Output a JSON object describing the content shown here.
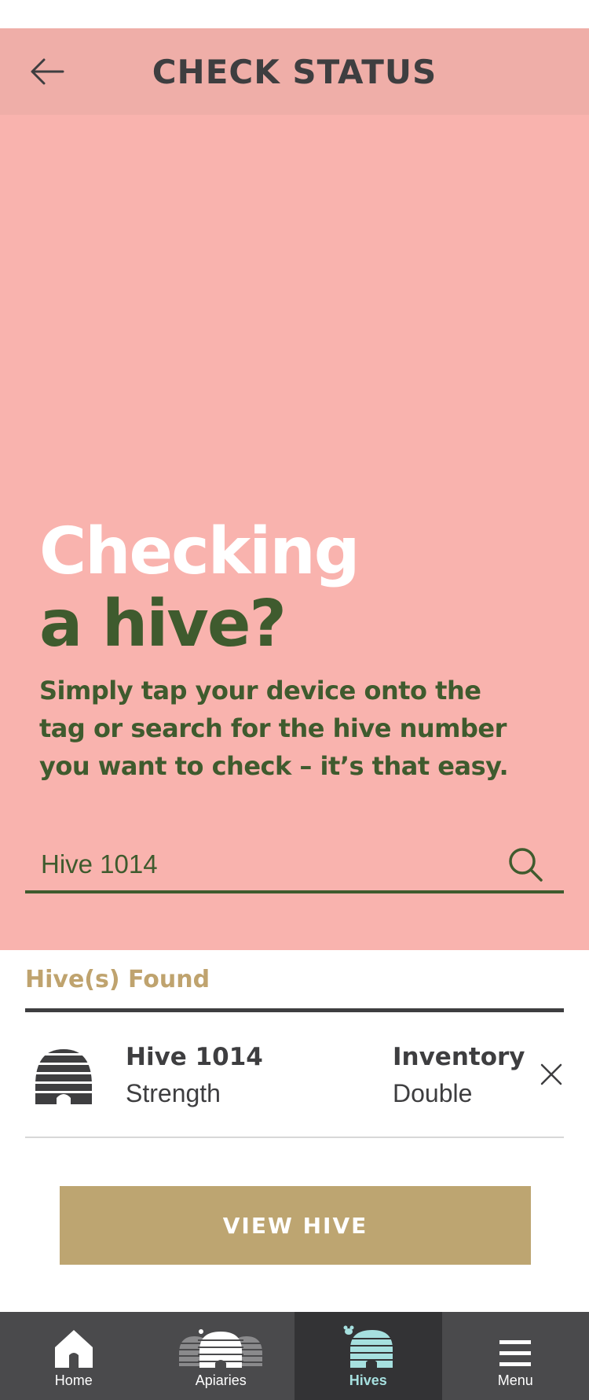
{
  "header": {
    "title": "CHECK STATUS",
    "back_icon": "arrow-left-icon"
  },
  "hero": {
    "title_line1": "Checking",
    "title_line2": "a hive?",
    "description": "Simply tap your device onto the tag or search for the hive number you want to check – it’s that easy."
  },
  "search": {
    "value": "Hive 1014",
    "icon": "search-icon"
  },
  "results": {
    "label": "Hive(s) Found",
    "items": [
      {
        "name": "Hive 1014",
        "strength": "Strength",
        "inventory_label": "Inventory",
        "inventory_value": "Double",
        "icon": "beehive-icon"
      }
    ]
  },
  "actions": {
    "view_hive": "VIEW HIVE"
  },
  "tabs": [
    {
      "label": "Home",
      "icon": "home-icon",
      "active": false
    },
    {
      "label": "Apiaries",
      "icon": "apiaries-icon",
      "active": false
    },
    {
      "label": "Hives",
      "icon": "hive-icon",
      "active": true
    },
    {
      "label": "Menu",
      "icon": "hamburger-menu-icon",
      "active": false
    }
  ],
  "colors": {
    "header_bg": "#efaea8",
    "hero_bg": "#f9b3ae",
    "green": "#3f5b2e",
    "gold": "#bda571",
    "dark": "#3e3e40",
    "tab_active_accent": "#a6e0df"
  }
}
